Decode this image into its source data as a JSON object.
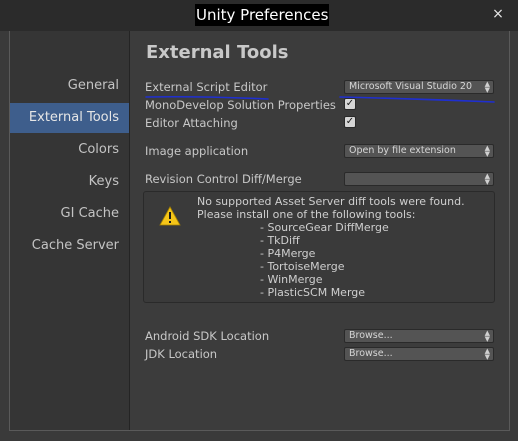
{
  "window": {
    "title": "Unity Preferences",
    "close_glyph": "×"
  },
  "sidebar": {
    "items": [
      {
        "label": "General"
      },
      {
        "label": "External Tools",
        "active": true
      },
      {
        "label": "Colors"
      },
      {
        "label": "Keys"
      },
      {
        "label": "GI Cache"
      },
      {
        "label": "Cache Server"
      }
    ]
  },
  "main": {
    "heading": "External Tools",
    "external_script_editor": {
      "label": "External Script Editor",
      "value": "Microsoft Visual Studio 20"
    },
    "monodevelop_solution_properties": {
      "label": "MonoDevelop Solution Properties",
      "checked": true
    },
    "editor_attaching": {
      "label": "Editor Attaching",
      "checked": true
    },
    "image_application": {
      "label": "Image application",
      "value": "Open by file extension"
    },
    "revision_control": {
      "label": "Revision Control Diff/Merge",
      "value": ""
    },
    "message": {
      "lines": [
        "No supported Asset Server diff tools were found.",
        "Please install one of the following tools:"
      ],
      "tools": [
        "- SourceGear DiffMerge",
        "- TkDiff",
        "- P4Merge",
        "- TortoiseMerge",
        "- WinMerge",
        "- PlasticSCM Merge"
      ]
    },
    "android_sdk": {
      "label": "Android SDK Location",
      "value": "Browse..."
    },
    "jdk": {
      "label": "JDK Location",
      "value": "Browse..."
    }
  },
  "icons": {
    "warning": "warning-icon",
    "close": "close-icon",
    "dropdown_arrows": "dropdown-arrows-icon",
    "checkmark": "checkmark-icon"
  },
  "colors": {
    "sidebar_active": "#3e5e8c",
    "warning_yellow": "#f5c518",
    "annotation_blue": "#1f2fd0"
  },
  "glyphs": {
    "check": "✓",
    "arrows_up": "▲",
    "arrows_down": "▼"
  }
}
